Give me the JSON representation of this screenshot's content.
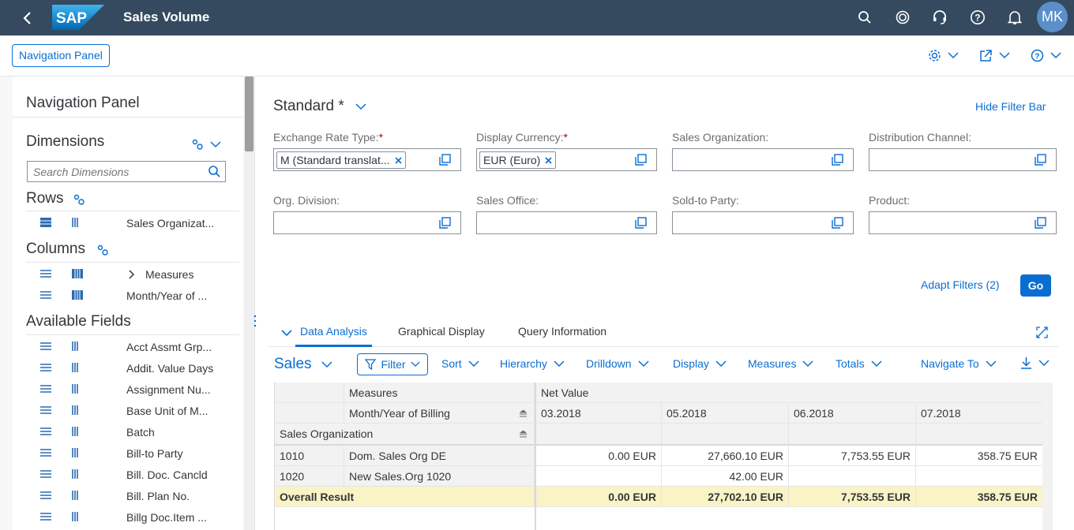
{
  "shell": {
    "title": "Sales Volume",
    "logo_text": "SAP",
    "avatar": "MK",
    "icons": [
      "back-icon",
      "search-icon",
      "copilot-icon",
      "headset-icon",
      "help-icon",
      "bell-icon"
    ]
  },
  "toolbar": {
    "nav_button": "Navigation Panel",
    "icons": [
      "settings-icon",
      "share-icon",
      "help-icon"
    ]
  },
  "nav_panel": {
    "title": "Navigation Panel",
    "dimensions_title": "Dimensions",
    "search_placeholder": "Search Dimensions",
    "rows_title": "Rows",
    "rows": [
      "Sales Organizat..."
    ],
    "columns_title": "Columns",
    "columns": [
      "Measures",
      "Month/Year of ..."
    ],
    "available_title": "Available Fields",
    "available": [
      "Acct Assmt Grp...",
      "Addit. Value Days",
      "Assignment Nu...",
      "Base Unit of M...",
      "Batch",
      "Bill-to Party",
      "Bill. Doc. Cancld",
      "Bill. Plan No.",
      "Billg Doc.Item ..."
    ]
  },
  "filterbar": {
    "variant": "Standard *",
    "hide_label": "Hide Filter Bar",
    "fields": {
      "exchange_rate": {
        "label": "Exchange Rate Type:",
        "token": "M (Standard translat..."
      },
      "display_currency": {
        "label": "Display Currency:",
        "token": "EUR (Euro)"
      },
      "sales_org": {
        "label": "Sales Organization:"
      },
      "dist_channel": {
        "label": "Distribution Channel:"
      },
      "org_division": {
        "label": "Org. Division:"
      },
      "sales_office": {
        "label": "Sales Office:"
      },
      "sold_to": {
        "label": "Sold-to Party:"
      },
      "product": {
        "label": "Product:"
      }
    },
    "required_mark": "*",
    "adapt_filters": "Adapt Filters (2)",
    "go": "Go"
  },
  "tabs": [
    "Data Analysis",
    "Graphical Display",
    "Query Information"
  ],
  "analysis_toolbar": {
    "title": "Sales",
    "filter": "Filter",
    "sort": "Sort",
    "hierarchy": "Hierarchy",
    "drilldown": "Drilldown",
    "display": "Display",
    "measures": "Measures",
    "totals": "Totals",
    "navigate": "Navigate To"
  },
  "grid": {
    "hdr_measures": "Measures",
    "hdr_month": "Month/Year of Billing",
    "hdr_salesorg": "Sales Organization",
    "hdr_netvalue": "Net Value",
    "months": [
      "03.2018",
      "05.2018",
      "06.2018",
      "07.2018"
    ],
    "rows": [
      {
        "code": "1010",
        "name": "Dom. Sales Org DE",
        "values": [
          "0.00 EUR",
          "27,660.10 EUR",
          "7,753.55 EUR",
          "358.75 EUR"
        ]
      },
      {
        "code": "1020",
        "name": "New Sales.Org 1020",
        "values": [
          "",
          "42.00 EUR",
          "",
          ""
        ]
      }
    ],
    "total": {
      "label": "Overall Result",
      "values": [
        "0.00 EUR",
        "27,702.10 EUR",
        "7,753.55 EUR",
        "358.75 EUR"
      ]
    }
  },
  "colors": {
    "shell": "#354a5f",
    "accent": "#0a6ed1",
    "total_bg": "#faf3c6"
  }
}
